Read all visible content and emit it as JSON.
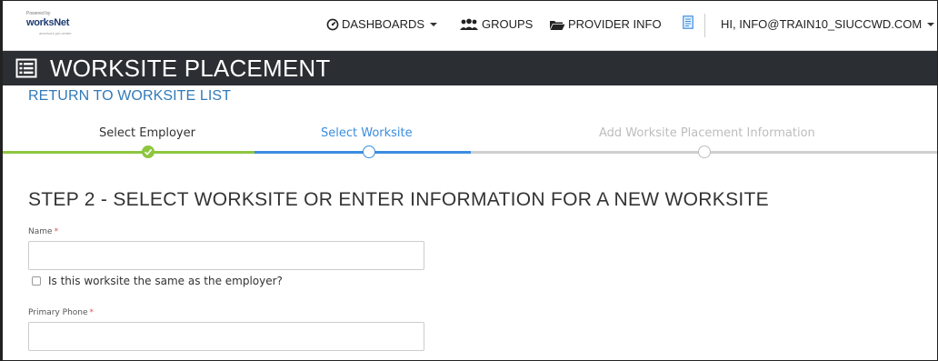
{
  "logo": {
    "text_main": "worksNet",
    "text_small_top": "Powered by",
    "text_small_bottom": "america's job center"
  },
  "nav": {
    "dashboards": "DASHBOARDS",
    "groups": "GROUPS",
    "provider_info": "PROVIDER INFO",
    "user": "HI, INFO@TRAIN10_SIUCCWD.COM"
  },
  "page": {
    "title": "WORKSITE PLACEMENT",
    "return_link": "RETURN TO WORKSITE LIST"
  },
  "stepper": {
    "steps": [
      {
        "label": "Select Employer",
        "state": "complete",
        "color": "#8dc63f"
      },
      {
        "label": "Select Worksite",
        "state": "active",
        "color": "#3a8de0"
      },
      {
        "label": "Add Worksite Placement Information",
        "state": "inactive",
        "color": "#c8c8c8"
      }
    ]
  },
  "form": {
    "heading": "STEP 2 - SELECT WORKSITE OR ENTER INFORMATION FOR A NEW WORKSITE",
    "name_label": "Name",
    "required_mark": "*",
    "name_value": "",
    "same_as_employer_label": "Is this worksite the same as the employer?",
    "phone_label": "Primary Phone",
    "phone_value": ""
  },
  "colors": {
    "titlebar_bg": "#2b2f33",
    "link": "#337ab7",
    "required": "#d9534f"
  }
}
